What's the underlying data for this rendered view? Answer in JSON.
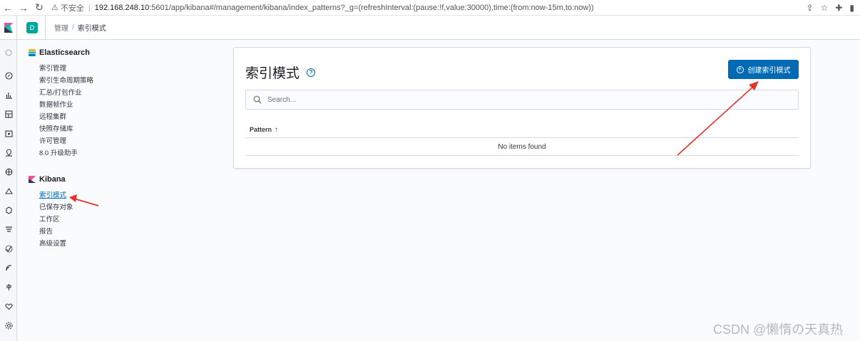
{
  "browser": {
    "insecure_label": "不安全",
    "url_host": "192.168.248.10",
    "url_rest": ":5601/app/kibana#/management/kibana/index_patterns?_g=(refreshInterval:(pause:!f,value:30000),time:(from:now-15m,to:now))"
  },
  "header": {
    "space_initial": "D",
    "breadcrumb_root": "管理",
    "breadcrumb_current": "索引模式"
  },
  "sidebar": {
    "elasticsearch": {
      "title": "Elasticsearch",
      "items": [
        "索引管理",
        "索引生命周期策略",
        "汇总/打包作业",
        "数据帧作业",
        "远程集群",
        "快照存储库",
        "许可管理",
        "8.0 升级助手"
      ]
    },
    "kibana": {
      "title": "Kibana",
      "items": [
        "索引模式",
        "已保存对象",
        "工作区",
        "报告",
        "高级设置"
      ],
      "selected_index": 0
    }
  },
  "main": {
    "title": "索引模式",
    "create_button": "创建索引模式",
    "search_placeholder": "Search...",
    "table": {
      "column": "Pattern",
      "empty": "No items found"
    }
  },
  "watermark": "CSDN @懒惰の天真热",
  "colors": {
    "primary": "#006bb4",
    "annotation_arrow": "#e8312a"
  }
}
